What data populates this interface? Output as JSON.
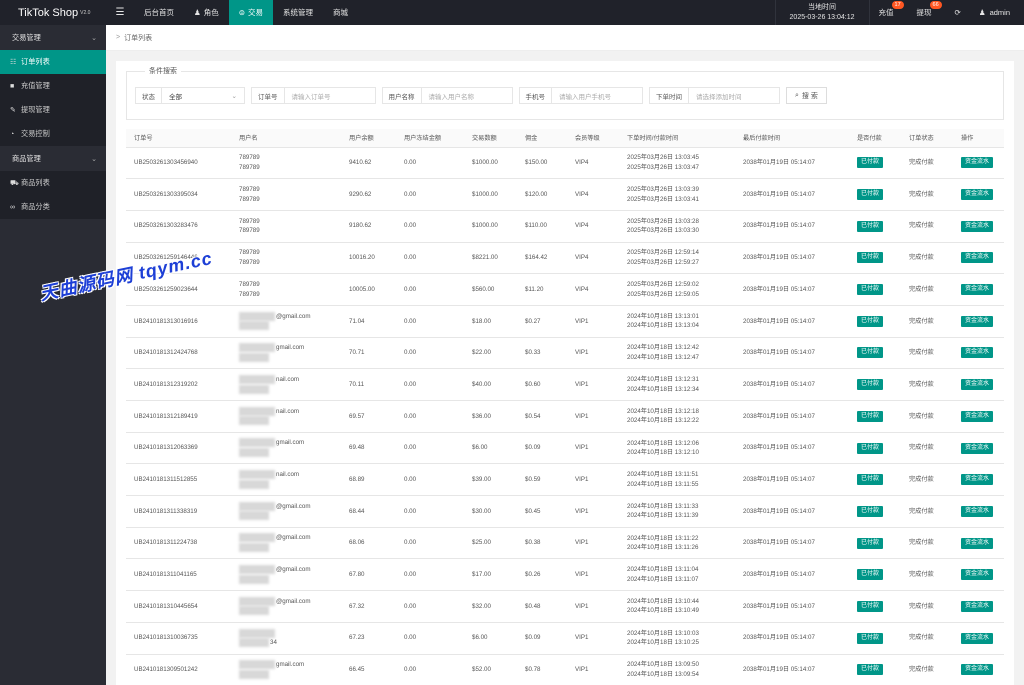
{
  "brand": {
    "name": "TikTok Shop",
    "version": "V2.0"
  },
  "topnav": [
    {
      "label": "后台首页",
      "icon": ""
    },
    {
      "label": "角色",
      "icon": "user-icon"
    },
    {
      "label": "交易",
      "icon": "globe-icon"
    },
    {
      "label": "系统管理",
      "icon": ""
    },
    {
      "label": "商城",
      "icon": ""
    }
  ],
  "header": {
    "time_label": "当地时间",
    "time_value": "2025-03-26 13:04:12",
    "recharge_label": "充值",
    "recharge_badge": "17",
    "withdraw_label": "提现",
    "withdraw_badge": "66",
    "user": "admin"
  },
  "sidebar": {
    "groups": [
      {
        "label": "交易管理",
        "items": [
          {
            "label": "订单列表",
            "icon": "list-icon"
          },
          {
            "label": "充值管理",
            "icon": "comment-icon"
          },
          {
            "label": "提现管理",
            "icon": "wrench-icon"
          },
          {
            "label": "交易控制",
            "icon": "gauge-icon"
          }
        ]
      },
      {
        "label": "商品管理",
        "items": [
          {
            "label": "商品列表",
            "icon": "cart-icon"
          },
          {
            "label": "商品分类",
            "icon": "link-icon"
          }
        ]
      }
    ]
  },
  "breadcrumb": {
    "sep": ">",
    "label": "订单列表"
  },
  "filters": {
    "legend": "条件搜索",
    "status_label": "状态",
    "status_value": "全部",
    "order_label": "订单号",
    "order_placeholder": "请输入订单号",
    "username_label": "用户名称",
    "username_placeholder": "请输入用户名称",
    "phone_label": "手机号",
    "phone_placeholder": "请输入用户手机号",
    "time_label": "下单时间",
    "time_placeholder": "请选择添加时间",
    "search_label": "搜 索"
  },
  "table": {
    "columns": [
      "订单号",
      "用户名",
      "用户余额",
      "用户冻结金额",
      "交易数额",
      "佣金",
      "会员等级",
      "下单时间/付款时间",
      "最后付款时间",
      "是否付款",
      "订单状态",
      "操作"
    ],
    "rows": [
      {
        "id": "UB2503261303456940",
        "user1": "789789",
        "user2": "789789",
        "balance": "9410.62",
        "frozen": "0.00",
        "amount": "$1000.00",
        "commission": "$150.00",
        "vip": "VIP4",
        "t1": "2025年03月26日 13:03:45",
        "t2": "2025年03月26日 13:03:47",
        "last": "2038年01月19日 05:14:07",
        "paid": "已付款",
        "status": "完成付款",
        "action": "资金流水"
      },
      {
        "id": "UB2503261303395034",
        "user1": "789789",
        "user2": "789789",
        "balance": "9290.62",
        "frozen": "0.00",
        "amount": "$1000.00",
        "commission": "$120.00",
        "vip": "VIP4",
        "t1": "2025年03月26日 13:03:39",
        "t2": "2025年03月26日 13:03:41",
        "last": "2038年01月19日 05:14:07",
        "paid": "已付款",
        "status": "完成付款",
        "action": "资金流水"
      },
      {
        "id": "UB2503261303283476",
        "user1": "789789",
        "user2": "789789",
        "balance": "9180.62",
        "frozen": "0.00",
        "amount": "$1000.00",
        "commission": "$110.00",
        "vip": "VIP4",
        "t1": "2025年03月26日 13:03:28",
        "t2": "2025年03月26日 13:03:30",
        "last": "2038年01月19日 05:14:07",
        "paid": "已付款",
        "status": "完成付款",
        "action": "资金流水"
      },
      {
        "id": "UB2503261259146446",
        "user1": "789789",
        "user2": "789789",
        "balance": "10016.20",
        "frozen": "0.00",
        "amount": "$8221.00",
        "commission": "$164.42",
        "vip": "VIP4",
        "t1": "2025年03月26日 12:59:14",
        "t2": "2025年03月26日 12:59:27",
        "last": "2038年01月19日 05:14:07",
        "paid": "已付款",
        "status": "完成付款",
        "action": "资金流水"
      },
      {
        "id": "UB2503261259023644",
        "user1": "789789",
        "user2": "789789",
        "balance": "10005.00",
        "frozen": "0.00",
        "amount": "$560.00",
        "commission": "$11.20",
        "vip": "VIP4",
        "t1": "2025年03月26日 12:59:02",
        "t2": "2025年03月26日 12:59:05",
        "last": "2038年01月19日 05:14:07",
        "paid": "已付款",
        "status": "完成付款",
        "action": "资金流水"
      },
      {
        "id": "UB2410181313016916",
        "user1": "@gmail.com",
        "user2": "",
        "balance": "71.04",
        "frozen": "0.00",
        "amount": "$18.00",
        "commission": "$0.27",
        "vip": "VIP1",
        "t1": "2024年10月18日 13:13:01",
        "t2": "2024年10月18日 13:13:04",
        "last": "2038年01月19日 05:14:07",
        "paid": "已付款",
        "status": "完成付款",
        "action": "资金流水"
      },
      {
        "id": "UB2410181312424768",
        "user1": "gmail.com",
        "user2": "",
        "balance": "70.71",
        "frozen": "0.00",
        "amount": "$22.00",
        "commission": "$0.33",
        "vip": "VIP1",
        "t1": "2024年10月18日 13:12:42",
        "t2": "2024年10月18日 13:12:47",
        "last": "2038年01月19日 05:14:07",
        "paid": "已付款",
        "status": "完成付款",
        "action": "资金流水"
      },
      {
        "id": "UB2410181312319202",
        "user1": "nail.com",
        "user2": "",
        "balance": "70.11",
        "frozen": "0.00",
        "amount": "$40.00",
        "commission": "$0.60",
        "vip": "VIP1",
        "t1": "2024年10月18日 13:12:31",
        "t2": "2024年10月18日 13:12:34",
        "last": "2038年01月19日 05:14:07",
        "paid": "已付款",
        "status": "完成付款",
        "action": "资金流水"
      },
      {
        "id": "UB2410181312189419",
        "user1": "nail.com",
        "user2": "",
        "balance": "69.57",
        "frozen": "0.00",
        "amount": "$36.00",
        "commission": "$0.54",
        "vip": "VIP1",
        "t1": "2024年10月18日 13:12:18",
        "t2": "2024年10月18日 13:12:22",
        "last": "2038年01月19日 05:14:07",
        "paid": "已付款",
        "status": "完成付款",
        "action": "资金流水"
      },
      {
        "id": "UB2410181312063369",
        "user1": "gmail.com",
        "user2": "",
        "balance": "69.48",
        "frozen": "0.00",
        "amount": "$6.00",
        "commission": "$0.09",
        "vip": "VIP1",
        "t1": "2024年10月18日 13:12:06",
        "t2": "2024年10月18日 13:12:10",
        "last": "2038年01月19日 05:14:07",
        "paid": "已付款",
        "status": "完成付款",
        "action": "资金流水"
      },
      {
        "id": "UB2410181311512855",
        "user1": "nail.com",
        "user2": "",
        "balance": "68.89",
        "frozen": "0.00",
        "amount": "$39.00",
        "commission": "$0.59",
        "vip": "VIP1",
        "t1": "2024年10月18日 13:11:51",
        "t2": "2024年10月18日 13:11:55",
        "last": "2038年01月19日 05:14:07",
        "paid": "已付款",
        "status": "完成付款",
        "action": "资金流水"
      },
      {
        "id": "UB2410181311338319",
        "user1": "@gmail.com",
        "user2": "",
        "balance": "68.44",
        "frozen": "0.00",
        "amount": "$30.00",
        "commission": "$0.45",
        "vip": "VIP1",
        "t1": "2024年10月18日 13:11:33",
        "t2": "2024年10月18日 13:11:39",
        "last": "2038年01月19日 05:14:07",
        "paid": "已付款",
        "status": "完成付款",
        "action": "资金流水"
      },
      {
        "id": "UB2410181311224738",
        "user1": "@gmail.com",
        "user2": "",
        "balance": "68.06",
        "frozen": "0.00",
        "amount": "$25.00",
        "commission": "$0.38",
        "vip": "VIP1",
        "t1": "2024年10月18日 13:11:22",
        "t2": "2024年10月18日 13:11:26",
        "last": "2038年01月19日 05:14:07",
        "paid": "已付款",
        "status": "完成付款",
        "action": "资金流水"
      },
      {
        "id": "UB2410181311041165",
        "user1": "@gmail.com",
        "user2": "",
        "balance": "67.80",
        "frozen": "0.00",
        "amount": "$17.00",
        "commission": "$0.26",
        "vip": "VIP1",
        "t1": "2024年10月18日 13:11:04",
        "t2": "2024年10月18日 13:11:07",
        "last": "2038年01月19日 05:14:07",
        "paid": "已付款",
        "status": "完成付款",
        "action": "资金流水"
      },
      {
        "id": "UB2410181310445654",
        "user1": "@gmail.com",
        "user2": "",
        "balance": "67.32",
        "frozen": "0.00",
        "amount": "$32.00",
        "commission": "$0.48",
        "vip": "VIP1",
        "t1": "2024年10月18日 13:10:44",
        "t2": "2024年10月18日 13:10:49",
        "last": "2038年01月19日 05:14:07",
        "paid": "已付款",
        "status": "完成付款",
        "action": "资金流水"
      },
      {
        "id": "UB2410181310036735",
        "user1": "",
        "user2": "34",
        "balance": "67.23",
        "frozen": "0.00",
        "amount": "$6.00",
        "commission": "$0.09",
        "vip": "VIP1",
        "t1": "2024年10月18日 13:10:03",
        "t2": "2024年10月18日 13:10:25",
        "last": "2038年01月19日 05:14:07",
        "paid": "已付款",
        "status": "完成付款",
        "action": "资金流水"
      },
      {
        "id": "UB2410181309501242",
        "user1": "gmail.com",
        "user2": "",
        "balance": "66.45",
        "frozen": "0.00",
        "amount": "$52.00",
        "commission": "$0.78",
        "vip": "VIP1",
        "t1": "2024年10月18日 13:09:50",
        "t2": "2024年10月18日 13:09:54",
        "last": "2038年01月19日 05:14:07",
        "paid": "已付款",
        "status": "完成付款",
        "action": "资金流水"
      }
    ]
  },
  "watermark": "天曲源码网 tqym.cc",
  "colors": {
    "accent": "#009688",
    "topbar": "#20222a",
    "sidebar": "#2a2c34",
    "badge": "#ff5722"
  }
}
